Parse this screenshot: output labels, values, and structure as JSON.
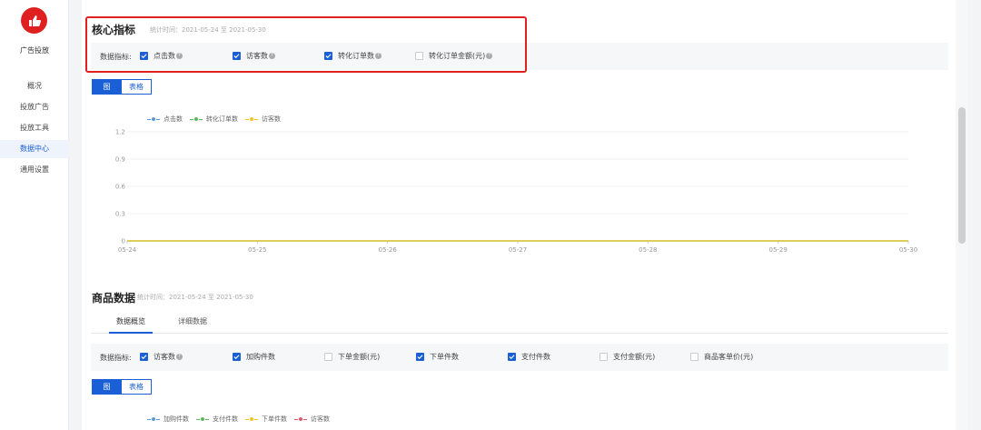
{
  "sidebar": {
    "app_title": "广告投放",
    "items": [
      {
        "label": "概况"
      },
      {
        "label": "投放广告"
      },
      {
        "label": "投放工具"
      },
      {
        "label": "数据中心"
      },
      {
        "label": "通用设置"
      }
    ],
    "active_index": 3
  },
  "core": {
    "title": "核心指标",
    "meta": "统计时间：2021-05-24 至 2021-05-30",
    "metrics_label": "数据指标:",
    "metrics": [
      {
        "label": "点击数",
        "checked": true
      },
      {
        "label": "访客数",
        "checked": true
      },
      {
        "label": "转化订单数",
        "checked": true
      },
      {
        "label": "转化订单金额(元)",
        "checked": false
      }
    ],
    "toggle": {
      "chart": "图",
      "table": "表格"
    },
    "legend": [
      {
        "name": "点击数",
        "color": "#5b9bd5"
      },
      {
        "name": "转化订单数",
        "color": "#5cb85c"
      },
      {
        "name": "访客数",
        "color": "#f5c518"
      }
    ]
  },
  "chart_data": {
    "type": "line",
    "x": [
      "05-24",
      "05-25",
      "05-26",
      "05-27",
      "05-28",
      "05-29",
      "05-30"
    ],
    "y_ticks": [
      "1.2",
      "0.9",
      "0.6",
      "0.3",
      "0"
    ],
    "ylim": [
      0,
      1.2
    ],
    "series": [
      {
        "name": "点击数",
        "values": [
          0,
          0,
          0,
          0,
          0,
          0,
          0
        ],
        "color": "#5b9bd5"
      },
      {
        "name": "转化订单数",
        "values": [
          0,
          0,
          0,
          0,
          0,
          0,
          0
        ],
        "color": "#5cb85c"
      },
      {
        "name": "访客数",
        "values": [
          0,
          0,
          0,
          0,
          0,
          0,
          0
        ],
        "color": "#f5c518"
      }
    ],
    "grid": true,
    "legend_position": "top-left"
  },
  "goods": {
    "title": "商品数据",
    "meta": "统计时间：2021-05-24 至 2021-05-30",
    "tabs": [
      {
        "label": "数据概览"
      },
      {
        "label": "详细数据"
      }
    ],
    "active_tab": 0,
    "metrics_label": "数据指标:",
    "metrics": [
      {
        "label": "访客数",
        "checked": true,
        "info": true
      },
      {
        "label": "加购件数",
        "checked": true,
        "info": false
      },
      {
        "label": "下单金额(元)",
        "checked": false,
        "info": false
      },
      {
        "label": "下单件数",
        "checked": true,
        "info": false
      },
      {
        "label": "支付件数",
        "checked": true,
        "info": false
      },
      {
        "label": "支付金额(元)",
        "checked": false,
        "info": false
      },
      {
        "label": "商品客单价(元)",
        "checked": false,
        "info": false
      }
    ],
    "toggle": {
      "chart": "图",
      "table": "表格"
    },
    "legend": [
      {
        "name": "加购件数",
        "color": "#5b9bd5"
      },
      {
        "name": "支付件数",
        "color": "#5cb85c"
      },
      {
        "name": "下单件数",
        "color": "#f5c518"
      },
      {
        "name": "访客数",
        "color": "#e05a6a"
      }
    ]
  }
}
